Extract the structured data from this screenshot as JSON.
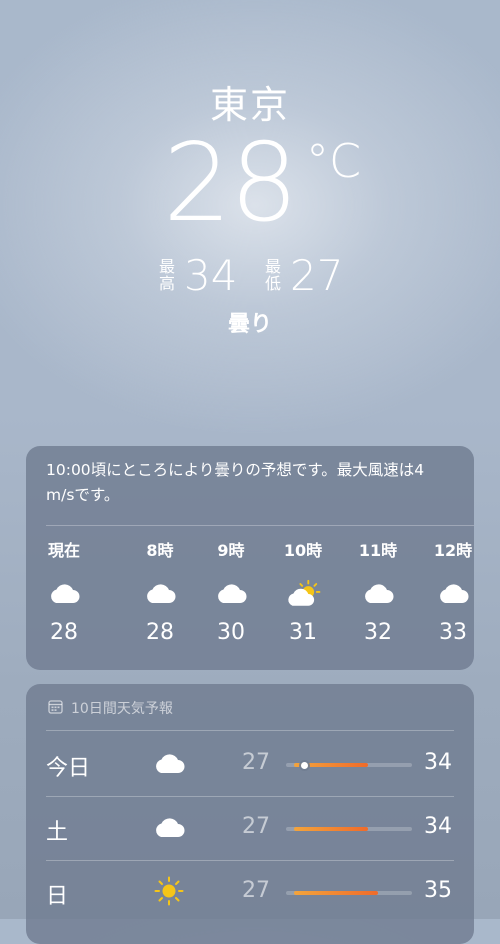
{
  "header": {
    "city": "東京",
    "temperature": "28",
    "unit": "°C",
    "high_label": "最高",
    "high": "34",
    "low_label": "最低",
    "low": "27",
    "condition": "曇り"
  },
  "hourly": {
    "summary": "10:00頃にところにより曇りの予想です。最大風速は4 m/sです。",
    "items": [
      {
        "label": "現在",
        "icon": "cloud-icon",
        "temp": "28"
      },
      {
        "label": "8時",
        "icon": "cloud-icon",
        "temp": "28"
      },
      {
        "label": "9時",
        "icon": "cloud-icon",
        "temp": "30"
      },
      {
        "label": "10時",
        "icon": "partly-sunny-icon",
        "temp": "31"
      },
      {
        "label": "11時",
        "icon": "cloud-icon",
        "temp": "32"
      },
      {
        "label": "12時",
        "icon": "cloud-icon",
        "temp": "33"
      }
    ]
  },
  "daily": {
    "title": "10日間天気予報",
    "title_icon": "calendar-icon",
    "range": {
      "min": 27,
      "max": 35
    },
    "days": [
      {
        "day": "今日",
        "icon": "cloud-icon",
        "low": "27",
        "high": "34",
        "current": 28
      },
      {
        "day": "土",
        "icon": "cloud-icon",
        "low": "27",
        "high": "34"
      },
      {
        "day": "日",
        "icon": "sun-icon",
        "low": "27",
        "high": "35"
      }
    ]
  },
  "colors": {
    "range_bar_start": "#f3a43c",
    "range_bar_end": "#f06b2a",
    "sun": "#f5c518"
  }
}
